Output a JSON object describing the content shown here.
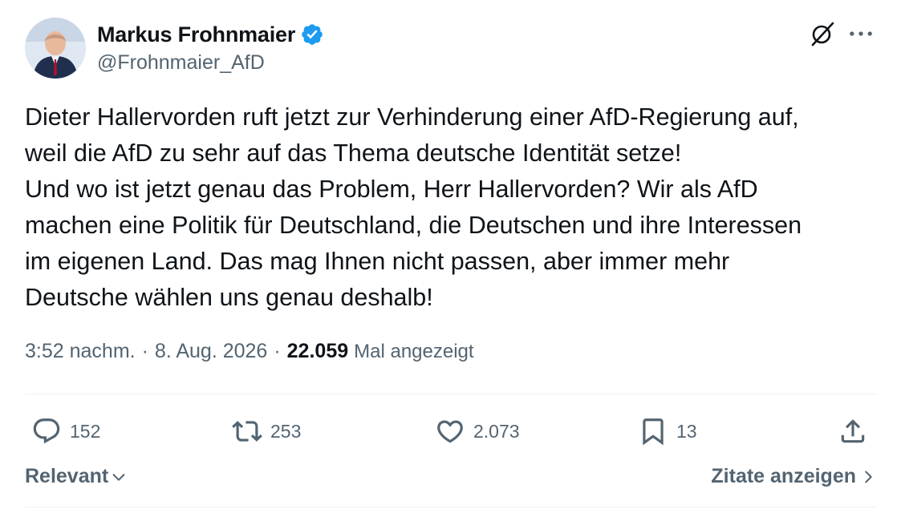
{
  "author": {
    "display_name": "Markus Frohnmaier",
    "handle": "@Frohnmaier_AfD",
    "verified": true
  },
  "tweet": {
    "text": "Dieter Hallervorden ruft jetzt zur Verhinderung einer AfD-Regierung auf,\nweil die AfD zu sehr auf das Thema deutsche Identität setze!\nUnd wo ist jetzt genau das Problem, Herr Hallervorden? Wir als AfD\nmachen eine Politik für Deutschland, die Deutschen und ihre Interessen\nim eigenen Land. Das mag Ihnen nicht passen, aber immer mehr\nDeutsche wählen uns genau deshalb!",
    "time": "3:52 nachm.",
    "date": "8. Aug. 2026",
    "separator": "·",
    "views_count": "22.059",
    "views_label": "Mal angezeigt"
  },
  "actions": {
    "replies": "152",
    "reposts": "253",
    "likes": "2.073",
    "bookmarks": "13"
  },
  "footer": {
    "sort_label": "Relevant",
    "quotes_label": "Zitate anzeigen"
  },
  "colors": {
    "text": "#0f1419",
    "secondary": "#536471",
    "verified_blue": "#1d9bf0",
    "divider": "#eff3f4"
  },
  "icons": {
    "grok": "grok-icon",
    "more": "more-icon",
    "reply": "reply-icon",
    "repost": "repost-icon",
    "like": "heart-icon",
    "bookmark": "bookmark-icon",
    "share": "share-icon"
  }
}
